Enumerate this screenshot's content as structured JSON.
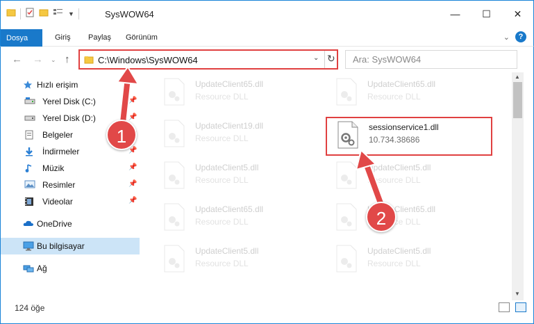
{
  "window": {
    "title": "SysWOW64",
    "minimize_glyph": "—",
    "maximize_glyph": "☐",
    "close_glyph": "✕"
  },
  "ribbon": {
    "tabs": [
      "Dosya",
      "Giriş",
      "Paylaş",
      "Görünüm"
    ],
    "active_tab": "Dosya"
  },
  "address": {
    "path": "C:\\Windows\\SysWOW64",
    "search_placeholder": "Ara: SysWOW64"
  },
  "sidebar": {
    "quick_access": "Hızlı erişim",
    "items": [
      {
        "label": "Yerel Disk (C:)",
        "icon": "drive-icon"
      },
      {
        "label": "Yerel Disk (D:)",
        "icon": "drive-icon"
      },
      {
        "label": "Belgeler",
        "icon": "documents-icon"
      },
      {
        "label": "İndirmeler",
        "icon": "downloads-icon"
      },
      {
        "label": "Müzik",
        "icon": "music-icon"
      },
      {
        "label": "Resimler",
        "icon": "pictures-icon"
      },
      {
        "label": "Videolar",
        "icon": "videos-icon"
      }
    ],
    "onedrive": "OneDrive",
    "this_pc": "Bu bilgisayar",
    "network": "Ağ"
  },
  "files": [
    {
      "name": "UpdateClient65.dll",
      "desc": "Resource DLL"
    },
    {
      "name": "UpdateClient65.dll",
      "desc": "Resource DLL"
    },
    {
      "name": "UpdateClient19.dll",
      "desc": "Resource DLL"
    },
    {
      "name": "sessionservice1.dll",
      "desc": "10.734.38686"
    },
    {
      "name": "UpdateClient5.dll",
      "desc": "Resource DLL"
    },
    {
      "name": "UpdateClient5.dll",
      "desc": "Resource DLL"
    },
    {
      "name": "UpdateClient65.dll",
      "desc": "Resource DLL"
    },
    {
      "name": "UpdateClient65.dll",
      "desc": "Resource DLL"
    },
    {
      "name": "UpdateClient5.dll",
      "desc": "Resource DLL"
    },
    {
      "name": "UpdateClient5.dll",
      "desc": "Resource DLL"
    }
  ],
  "status": {
    "item_count": "124 öğe"
  },
  "annotations": {
    "step1": "1",
    "step2": "2"
  },
  "colors": {
    "accent": "#1979ca",
    "highlight_red": "#e04040",
    "selected_bg": "#cce4f7"
  }
}
